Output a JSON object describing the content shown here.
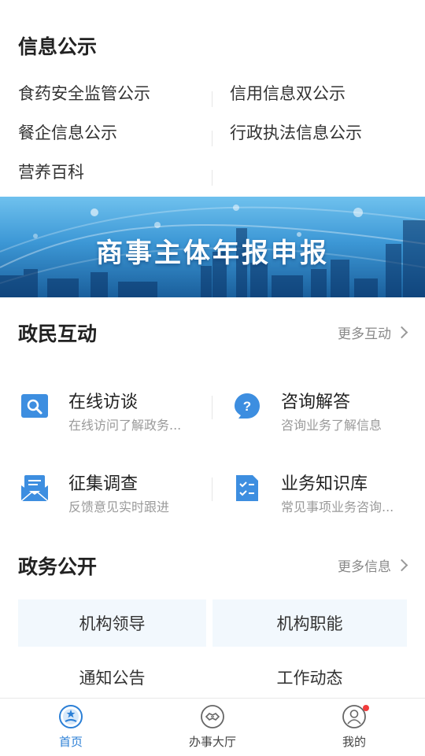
{
  "info": {
    "title": "信息公示",
    "links": [
      "食药安全监管公示",
      "信用信息双公示",
      "餐企信息公示",
      "行政执法信息公示",
      "营养百科"
    ]
  },
  "banner": {
    "title": "商事主体年报申报"
  },
  "interaction": {
    "title": "政民互动",
    "more": "更多互动",
    "cards": [
      {
        "title": "在线访谈",
        "subtitle": "在线访问了解政务...",
        "icon": "search-chat-icon"
      },
      {
        "title": "咨询解答",
        "subtitle": "咨询业务了解信息",
        "icon": "question-bubble-icon"
      },
      {
        "title": "征集调查",
        "subtitle": "反馈意见实时跟进",
        "icon": "mail-survey-icon"
      },
      {
        "title": "业务知识库",
        "subtitle": "常见事项业务咨询...",
        "icon": "checklist-icon"
      }
    ]
  },
  "gov": {
    "title": "政务公开",
    "more": "更多信息",
    "buttons": [
      "机构领导",
      "机构职能",
      "通知公告",
      "工作动态"
    ]
  },
  "tabbar": {
    "items": [
      {
        "label": "首页",
        "icon": "home-emblem-icon",
        "active": true
      },
      {
        "label": "办事大厅",
        "icon": "handshake-icon",
        "active": false
      },
      {
        "label": "我的",
        "icon": "user-icon",
        "active": false,
        "badge": true
      }
    ]
  },
  "colors": {
    "accent": "#2b7fd6",
    "icon_blue": "#3d8ee0",
    "badge": "#f23c3c",
    "button_bg": "#f2f8fd"
  }
}
